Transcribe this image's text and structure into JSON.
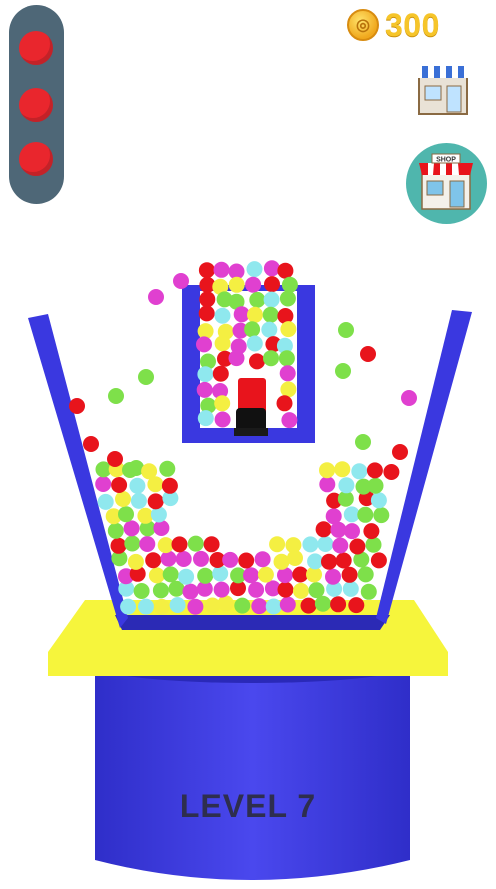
{
  "hud": {
    "coins": "300",
    "lives_total": 3,
    "lives_remaining": 3,
    "level_label": "LEVEL 7"
  },
  "icons": {
    "coin": "coin-icon",
    "shop": "shop-icon",
    "shop_round": "shop-round-icon",
    "life": "life-dot-icon"
  },
  "shop_sign": "SHOP",
  "colors": {
    "ball_red": "#e8141c",
    "ball_green": "#7ee04a",
    "ball_magenta": "#e040d0",
    "ball_cyan": "#8fe8ee",
    "ball_yellow": "#f4ef42",
    "cup_blue": "#3a38e0",
    "platform_yellow": "#f6f53c",
    "coin_gold": "#f6c52a"
  }
}
